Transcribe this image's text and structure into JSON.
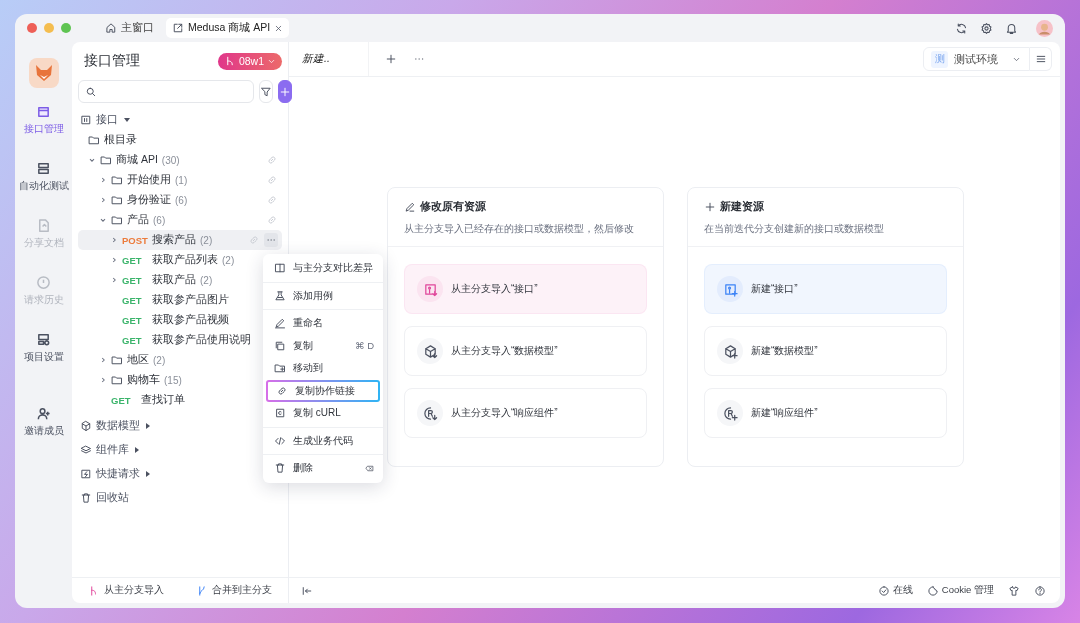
{
  "titlebar": {
    "tabs": [
      {
        "label": "主窗口",
        "selected": false,
        "closable": false
      },
      {
        "label": "Medusa 商城 API",
        "selected": true,
        "closable": true
      }
    ]
  },
  "rail": {
    "items": [
      {
        "label": "接口管理",
        "selected": true,
        "disabled": false
      },
      {
        "label": "自动化测试",
        "selected": false,
        "disabled": false
      },
      {
        "label": "分享文档",
        "selected": false,
        "disabled": true
      },
      {
        "label": "请求历史",
        "selected": false,
        "disabled": true
      },
      {
        "label": "项目设置",
        "selected": false,
        "disabled": false
      }
    ],
    "invite": "邀请成员"
  },
  "sidebar": {
    "title": "接口管理",
    "branch": "08w1",
    "section_label": "接口",
    "tree": [
      {
        "kind": "folder",
        "name": "根目录",
        "selected": false
      },
      {
        "kind": "folder",
        "name": "商城 API",
        "count": "(30)",
        "has_link": true,
        "expanded": true,
        "selected": false,
        "children": [
          {
            "kind": "folder",
            "name": "开始使用",
            "count": "(1)",
            "has_link": true,
            "expanded": false,
            "selected": false
          },
          {
            "kind": "folder",
            "name": "身份验证",
            "count": "(6)",
            "has_link": true,
            "expanded": false,
            "selected": false
          },
          {
            "kind": "folder",
            "name": "产品",
            "count": "(6)",
            "has_link": true,
            "expanded": true,
            "selected": false,
            "children": [
              {
                "kind": "endpoint",
                "method": "POST",
                "color": "#ec7b3b",
                "name": "搜索产品",
                "count": "(2)",
                "expanded": false,
                "selected": true
              },
              {
                "kind": "endpoint",
                "method": "GET",
                "color": "#3bb46b",
                "name": "获取产品列表",
                "count": "(2)",
                "expanded": false,
                "selected": false
              },
              {
                "kind": "endpoint",
                "method": "GET",
                "color": "#3bb46b",
                "name": "获取产品",
                "count": "(2)",
                "expanded": false,
                "selected": false
              },
              {
                "kind": "endpoint",
                "method": "GET",
                "color": "#3bb46b",
                "name": "获取参产品图片",
                "selected": false
              },
              {
                "kind": "endpoint",
                "method": "GET",
                "color": "#3bb46b",
                "name": "获取参产品视频",
                "selected": false
              },
              {
                "kind": "endpoint",
                "method": "GET",
                "color": "#3bb46b",
                "name": "获取参产品使用说明",
                "selected": false
              }
            ]
          },
          {
            "kind": "folder",
            "name": "地区",
            "count": "(2)",
            "expanded": false,
            "selected": false
          },
          {
            "kind": "folder",
            "name": "购物车",
            "count": "(15)",
            "expanded": false,
            "selected": false
          },
          {
            "kind": "endpoint",
            "method": "GET",
            "color": "#3bb46b",
            "name": "查找订单",
            "selected": false
          }
        ]
      }
    ],
    "sections": [
      {
        "label": "数据模型",
        "has_arrow": true
      },
      {
        "label": "组件库",
        "has_arrow": true
      },
      {
        "label": "快捷请求",
        "has_arrow": true
      },
      {
        "label": "回收站",
        "has_arrow": false
      }
    ],
    "footer": [
      "从主分支导入",
      "合并到主分支"
    ]
  },
  "context_menu": {
    "groups": [
      [
        {
          "label": "与主分支对比差异",
          "highlighted": false
        }
      ],
      [
        {
          "label": "添加用例",
          "highlighted": false
        }
      ],
      [
        {
          "label": "重命名",
          "highlighted": false
        },
        {
          "label": "复制",
          "shortcut": "⌘ D",
          "highlighted": false
        },
        {
          "label": "移动到",
          "highlighted": false
        },
        {
          "label": "复制协作链接",
          "highlighted": true
        },
        {
          "label": "复制 cURL",
          "highlighted": false
        }
      ],
      [
        {
          "label": "生成业务代码",
          "highlighted": false
        }
      ],
      [
        {
          "label": "删除",
          "highlighted": false
        }
      ]
    ]
  },
  "editor": {
    "tabs": [
      {
        "label": "新建..",
        "selected": true
      }
    ],
    "environment": {
      "badge": "测",
      "label": "测试环境"
    },
    "cards": [
      {
        "kind": "import",
        "color": "#e0459a",
        "title": "修改原有资源",
        "description": "从主分支导入已经存在的接口或数据模型，然后修改",
        "options": [
          {
            "label": "从主分支导入“接口”",
            "highlighted": true
          },
          {
            "label": "从主分支导入“数据模型”",
            "highlighted": false
          },
          {
            "label": "从主分支导入“响应组件”",
            "highlighted": false
          }
        ]
      },
      {
        "kind": "create",
        "color": "#3b82f6",
        "title": "新建资源",
        "description": "在当前迭代分支创建新的接口或数据模型",
        "options": [
          {
            "label": "新建“接口”",
            "highlighted": true
          },
          {
            "label": "新建“数据模型”",
            "highlighted": false
          },
          {
            "label": "新建“响应组件”",
            "highlighted": false
          }
        ]
      }
    ]
  },
  "status_bar": {
    "online": "在线",
    "cookie": "Cookie 管理"
  }
}
